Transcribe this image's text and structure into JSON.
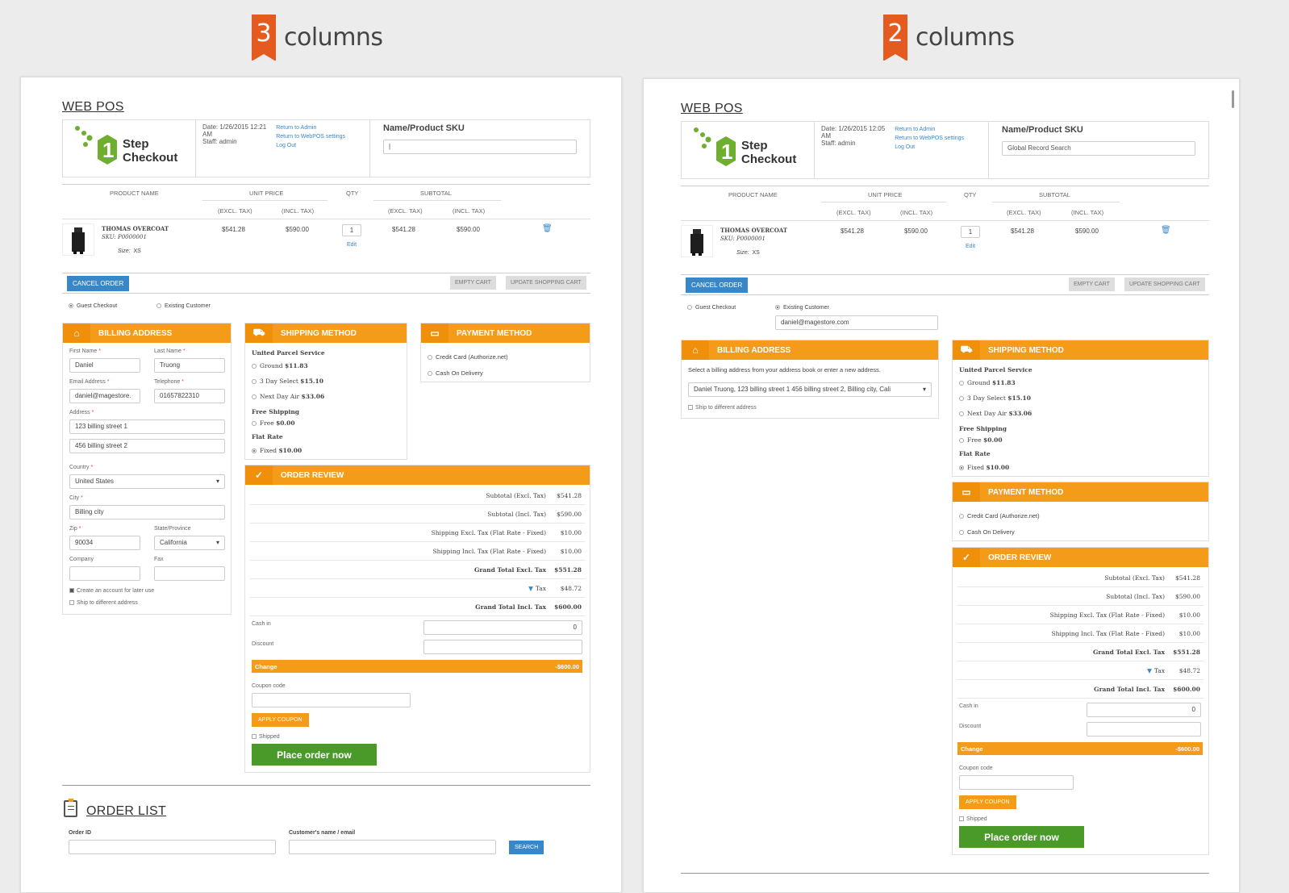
{
  "headers": {
    "left": {
      "number": "3",
      "word": "columns"
    },
    "right": {
      "number": "2",
      "word": "columns"
    }
  },
  "pos": {
    "title": "WEB POS",
    "logo_line1": "Step",
    "logo_line2": "Checkout",
    "logo_digit": "1",
    "date_label_left": "Date: 1/26/2015 12:21",
    "date_label_right": "Date: 1/26/2015 12:05",
    "ampm": "AM",
    "staff": "Staff: admin",
    "link_admin": "Return to Admin",
    "link_settings": "Return to WebPOS settings",
    "link_logout": "Log Out",
    "sku_title": "Name/Product SKU",
    "sku_value_left": "|",
    "sku_placeholder_right": "Global Record Search"
  },
  "cart": {
    "headers": {
      "product": "PRODUCT NAME",
      "unit_price": "UNIT PRICE",
      "qty": "QTY",
      "subtotal": "SUBTOTAL",
      "excl": "(EXCL. TAX)",
      "incl": "(INCL. TAX)"
    },
    "item": {
      "name": "THOMAS OVERCOAT",
      "sku": "SKU: P0000001",
      "size_label": "Size:",
      "size": "XS",
      "unit_excl": "$541.28",
      "unit_incl": "$590.00",
      "qty": "1",
      "edit": "Edit",
      "sub_excl": "$541.28",
      "sub_incl": "$590.00"
    },
    "cancel": "CANCEL ORDER",
    "empty": "EMPTY CART",
    "update": "UPDATE SHOPPING CART"
  },
  "customer": {
    "guest": "Guest Checkout",
    "existing": "Existing Customer",
    "email_value": "daniel@magestore.com"
  },
  "billing": {
    "title": "BILLING ADDRESS",
    "first_name_label": "First Name",
    "first_name": "Daniel",
    "last_name_label": "Last Name",
    "last_name": "Truong",
    "email_label": "Email Address",
    "email": "daniel@magestore.",
    "phone_label": "Telephone",
    "phone": "01657822310",
    "address_label": "Address",
    "address1": "123 billing street 1",
    "address2": "456 billing street 2",
    "country_label": "Country",
    "country": "United States",
    "city_label": "City",
    "city": "Billing city",
    "zip_label": "Zip",
    "zip": "90034",
    "state_label": "State/Province",
    "state": "California",
    "company_label": "Company",
    "fax_label": "Fax",
    "create_account": "Create an account for later use",
    "ship_diff": "Ship to different address",
    "select_note": "Select a billing address from your address book or enter a new address.",
    "address_select": "Daniel Truong, 123 billing street 1 456 billing street 2, Billing city, Cali"
  },
  "shipping": {
    "title": "SHIPPING METHOD",
    "ups": "United Parcel Service",
    "ground": "Ground",
    "ground_price": "$11.83",
    "three_day": "3 Day Select",
    "three_day_price": "$15.10",
    "next_day": "Next Day Air",
    "next_day_price": "$33.06",
    "free_title": "Free Shipping",
    "free": "Free",
    "free_price": "$0.00",
    "flat_title": "Flat Rate",
    "fixed": "Fixed",
    "fixed_price": "$10.00"
  },
  "payment": {
    "title": "PAYMENT METHOD",
    "cc": "Credit Card (Authorize.net)",
    "cod": "Cash On Delivery"
  },
  "review": {
    "title": "ORDER REVIEW",
    "rows": [
      {
        "label": "Subtotal (Excl. Tax)",
        "value": "$541.28",
        "bold": false
      },
      {
        "label": "Subtotal (Incl. Tax)",
        "value": "$590.00",
        "bold": false
      },
      {
        "label": "Shipping Excl. Tax (Flat Rate - Fixed)",
        "value": "$10.00",
        "bold": false
      },
      {
        "label": "Shipping Incl. Tax (Flat Rate - Fixed)",
        "value": "$10.00",
        "bold": false
      },
      {
        "label": "Grand Total Excl. Tax",
        "value": "$551.28",
        "bold": true
      },
      {
        "label": "Tax",
        "value": "$48.72",
        "bold": false
      },
      {
        "label": "Grand Total Incl. Tax",
        "value": "$600.00",
        "bold": true
      }
    ],
    "cash_in": "Cash in",
    "cash_value": "0",
    "discount": "Discount",
    "change": "Change",
    "change_value": "-$600.00",
    "coupon": "Coupon code",
    "apply": "APPLY COUPON",
    "shipped": "Shipped",
    "place": "Place order now"
  },
  "order_list": {
    "title": "ORDER LIST",
    "order_id": "Order ID",
    "customer": "Customer's name / email",
    "search": "SEARCH"
  },
  "colors": {
    "orange": "#f59b1a",
    "blue": "#3a87c8",
    "green": "#4a9a2a",
    "flag": "#e55b1f"
  }
}
